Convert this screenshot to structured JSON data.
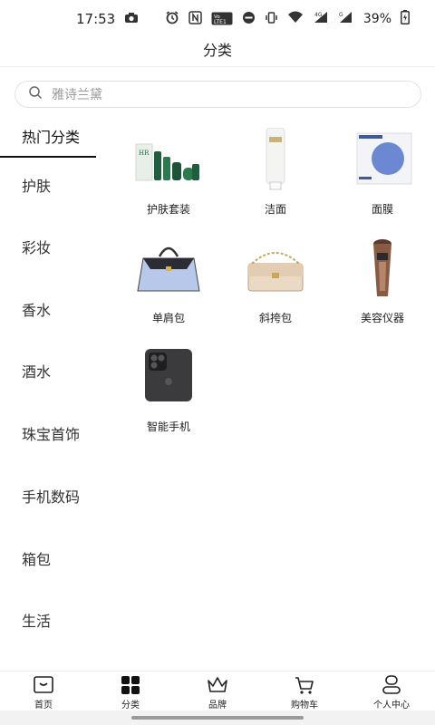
{
  "status_bar": {
    "time": "17:53",
    "volte_label": "Vo LTE 1",
    "signal_4g": "4G",
    "signal_g": "G",
    "battery": "39%"
  },
  "header": {
    "title": "分类"
  },
  "search": {
    "placeholder": "雅诗兰黛"
  },
  "sidebar": {
    "items": [
      {
        "label": "热门分类",
        "active": true
      },
      {
        "label": "护肤"
      },
      {
        "label": "彩妆"
      },
      {
        "label": "香水"
      },
      {
        "label": "酒水"
      },
      {
        "label": "珠宝首饰"
      },
      {
        "label": "手机数码"
      },
      {
        "label": "箱包"
      },
      {
        "label": "生活"
      }
    ]
  },
  "products": [
    {
      "label": "护肤套装",
      "icon": "skincare-set-image"
    },
    {
      "label": "洁面",
      "icon": "cleanser-tube-image"
    },
    {
      "label": "面膜",
      "icon": "face-mask-box-image"
    },
    {
      "label": "单肩包",
      "icon": "shoulder-bag-image"
    },
    {
      "label": "斜挎包",
      "icon": "crossbody-bag-image"
    },
    {
      "label": "美容仪器",
      "icon": "beauty-device-image"
    },
    {
      "label": "智能手机",
      "icon": "smartphone-image"
    }
  ],
  "tabbar": {
    "items": [
      {
        "label": "首页",
        "icon": "home-icon"
      },
      {
        "label": "分类",
        "icon": "category-icon",
        "active": true
      },
      {
        "label": "品牌",
        "icon": "crown-icon"
      },
      {
        "label": "购物车",
        "icon": "cart-icon"
      },
      {
        "label": "个人中心",
        "icon": "user-icon"
      }
    ]
  },
  "colors": {
    "accent": "#111111",
    "text": "#222222",
    "muted": "#999999",
    "border": "#e3e3e3"
  }
}
